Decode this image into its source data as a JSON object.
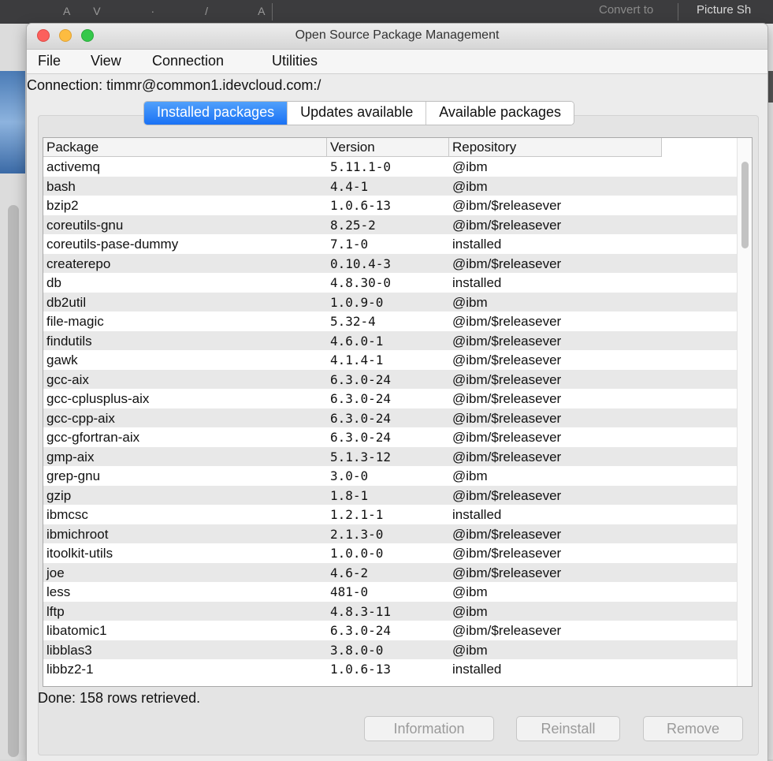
{
  "background": {
    "toolbar_left_glyphs": "AV · / A",
    "convert_label": "Convert to",
    "picture_label": "Picture  Sh"
  },
  "window": {
    "title": "Open Source Package Management"
  },
  "menu": {
    "items": [
      "File",
      "View",
      "Connection",
      "Utilities"
    ]
  },
  "connection": {
    "label": "Connection: timmr@common1.idevcloud.com:/"
  },
  "tabs": [
    {
      "label": "Installed packages",
      "active": true
    },
    {
      "label": "Updates available",
      "active": false
    },
    {
      "label": "Available packages",
      "active": false
    }
  ],
  "table": {
    "columns": [
      "Package",
      "Version",
      "Repository"
    ],
    "rows": [
      [
        "activemq",
        "5.11.1-0",
        "@ibm"
      ],
      [
        "bash",
        "4.4-1",
        "@ibm"
      ],
      [
        "bzip2",
        "1.0.6-13",
        "@ibm/$releasever"
      ],
      [
        "coreutils-gnu",
        "8.25-2",
        "@ibm/$releasever"
      ],
      [
        "coreutils-pase-dummy",
        "7.1-0",
        "installed"
      ],
      [
        "createrepo",
        "0.10.4-3",
        "@ibm/$releasever"
      ],
      [
        "db",
        "4.8.30-0",
        "installed"
      ],
      [
        "db2util",
        "1.0.9-0",
        "@ibm"
      ],
      [
        "file-magic",
        "5.32-4",
        "@ibm/$releasever"
      ],
      [
        "findutils",
        "4.6.0-1",
        "@ibm/$releasever"
      ],
      [
        "gawk",
        "4.1.4-1",
        "@ibm/$releasever"
      ],
      [
        "gcc-aix",
        "6.3.0-24",
        "@ibm/$releasever"
      ],
      [
        "gcc-cplusplus-aix",
        "6.3.0-24",
        "@ibm/$releasever"
      ],
      [
        "gcc-cpp-aix",
        "6.3.0-24",
        "@ibm/$releasever"
      ],
      [
        "gcc-gfortran-aix",
        "6.3.0-24",
        "@ibm/$releasever"
      ],
      [
        "gmp-aix",
        "5.1.3-12",
        "@ibm/$releasever"
      ],
      [
        "grep-gnu",
        "3.0-0",
        "@ibm"
      ],
      [
        "gzip",
        "1.8-1",
        "@ibm/$releasever"
      ],
      [
        "ibmcsc",
        "1.2.1-1",
        "installed"
      ],
      [
        "ibmichroot",
        "2.1.3-0",
        "@ibm/$releasever"
      ],
      [
        "itoolkit-utils",
        "1.0.0-0",
        "@ibm/$releasever"
      ],
      [
        "joe",
        "4.6-2",
        "@ibm/$releasever"
      ],
      [
        "less",
        "481-0",
        "@ibm"
      ],
      [
        "lftp",
        "4.8.3-11",
        "@ibm"
      ],
      [
        "libatomic1",
        "6.3.0-24",
        "@ibm/$releasever"
      ],
      [
        "libblas3",
        "3.8.0-0",
        "@ibm"
      ],
      [
        "libbz2-1",
        "1.0.6-13",
        "installed"
      ]
    ]
  },
  "status": "Done: 158 rows retrieved.",
  "buttons": {
    "information": "Information",
    "reinstall": "Reinstall",
    "remove": "Remove"
  },
  "colors": {
    "active_tab": "#1a72f5",
    "traffic_red": "#fc605c",
    "traffic_yellow": "#fdbc40",
    "traffic_green": "#34c84a"
  }
}
